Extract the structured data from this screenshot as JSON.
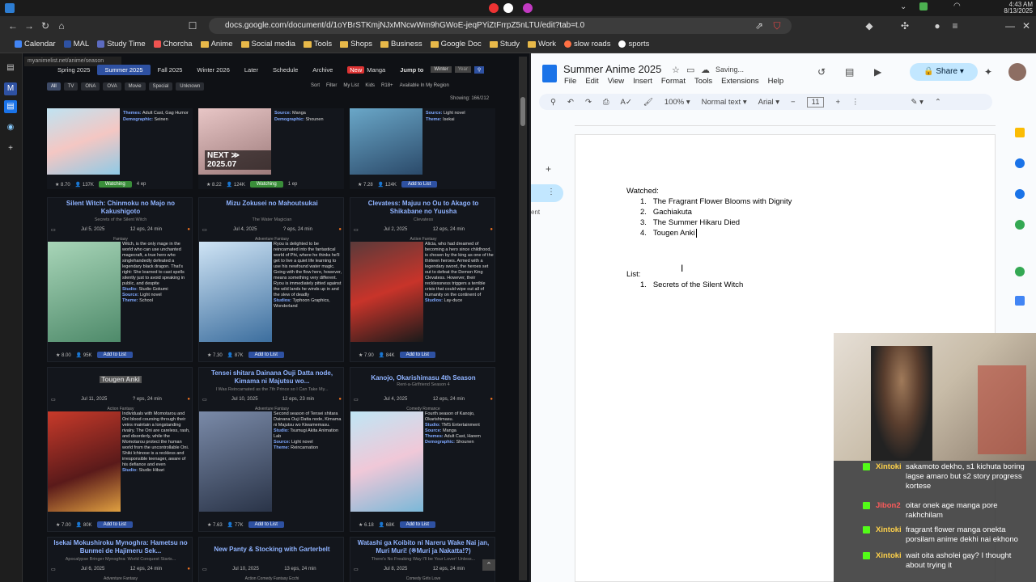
{
  "browser": {
    "url": "docs.google.com/document/d/1oYBrSTKmjNJxMNcwWm9hGWoE-jeqPYiZtFrrpZ5nLTU/edit?tab=t.0",
    "datetime_time": "4:43 AM",
    "datetime_date": "8/13/2025",
    "tooltip_url": "myanimelist.net/anime/season",
    "bookmarks": [
      "Calendar",
      "MAL",
      "Study Time",
      "Chorcha",
      "Anime",
      "Social media",
      "Tools",
      "Shops",
      "Business",
      "Google Doc",
      "Study",
      "Work",
      "slow roads",
      "sports"
    ]
  },
  "mal": {
    "season_tabs": [
      "Spring 2025",
      "Summer 2025",
      "Fall 2025",
      "Winter 2026",
      "Later",
      "Schedule",
      "Archive"
    ],
    "active_tab": "Summer 2025",
    "new_badge": "New",
    "manga_link": "Manga",
    "jump_to": "Jump to",
    "jump_select": "Winter",
    "jump_year": "Year",
    "filters": [
      "All",
      "TV",
      "ONA",
      "OVA",
      "Movie",
      "Special",
      "Unknown"
    ],
    "sort_opts": [
      "Sort",
      "Filter",
      "My List",
      "Kids",
      "R18+",
      "Available In My Region"
    ],
    "showing": "Showing: 166/212",
    "top_row": [
      {
        "themes_label": "Themes:",
        "themes": "Adult Cast, Gag Humor",
        "demo_label": "Demographic:",
        "demo": "Seinen",
        "score": "8.70",
        "members": "137K",
        "status": "Watching",
        "eps": "4 ep"
      },
      {
        "source_label": "Source:",
        "source": "Manga",
        "demo_label": "Demographic:",
        "demo": "Shounen",
        "banner": "NEXT ≫ 2025.07",
        "score": "8.22",
        "members": "124K",
        "status": "Watching",
        "eps": "1 ep"
      },
      {
        "source_label": "Source:",
        "source": "Light novel",
        "themes_label": "Theme:",
        "themes": "Isekai",
        "score": "7.28",
        "members": "124K",
        "status": "Add to List"
      }
    ],
    "cards": [
      {
        "title": "Silent Witch: Chinmoku no Majo no Kakushigoto",
        "subtitle": "Secrets of the Silent Witch",
        "date": "Jul 5, 2025",
        "eps": "12 eps, 24 min",
        "genres": "Fantasy",
        "synopsis": "Witch, is the only mage in the world who can use unchanted magecraft, a true hero who singlehandedly defeated a legendary black dragon. That's right: She learned to cast spells silently just to avoid speaking in public, and despite",
        "studio_label": "Studio:",
        "studio": "Studio Gokumi",
        "source_label": "Source:",
        "source": "Light novel",
        "theme_label": "Theme:",
        "theme": "School",
        "score": "8.00",
        "members": "95K",
        "action": "Add to List"
      },
      {
        "title": "Mizu Zokusei no Mahoutsukai",
        "subtitle": "The Water Magician",
        "date": "Jul 4, 2025",
        "eps": "? eps, 24 min",
        "genres": "Adventure  Fantasy",
        "synopsis": "Ryou is delighted to be reincarnated into the fantastical world of Phi, where he thinks he'll get to live a quiet life learning to use his newfound water magic. Going with the flow here, however, means something very different. Ryou is immediately pitted against the wild lands he winds up in and the slew of deadly",
        "studio_label": "Studios:",
        "studio": "Typhoon Graphics, Wonderland",
        "score": "7.30",
        "members": "87K",
        "action": "Add to List"
      },
      {
        "title": "Clevatess: Majuu no Ou to Akago to Shikabane no Yuusha",
        "subtitle": "Clevatess",
        "date": "Jul 2, 2025",
        "eps": "12 eps, 24 min",
        "genres": "Action  Fantasy",
        "synopsis": "Alicia, who had dreamed of becoming a hero since childhood, is chosen by the king as one of the thirteen heroes. Armed with a legendary sword, the heroes set out to defeat the Demon King Clevatess. However, their recklessness triggers a terrible crisis that could wipe out all of humanity on the continent of",
        "studio_label": "Studios:",
        "studio": "Lay-duce",
        "score": "7.90",
        "members": "84K",
        "action": "Add to List"
      },
      {
        "title": "Tougen Anki",
        "subtitle": "",
        "date": "Jul 11, 2025",
        "eps": "? eps, 24 min",
        "genres": "Action  Fantasy",
        "synopsis": "Individuals with Momotarou and Oni blood coursing through their veins maintain a longstanding rivalry. The Oni are careless, rash, and disorderly, while the Momotarou protect the human world from the uncontrollable Oni. Shiki Ichinose is a reckless and irresponsible teenager, aware of his defiance and even",
        "studio_label": "Studio:",
        "studio": "Studio Hibari",
        "score": "7.00",
        "members": "80K",
        "action": "Add to List"
      },
      {
        "title": "Tensei shitara Dainana Ouji Datta node, Kimama ni Majutsu wo...",
        "subtitle": "I Was Reincarnated as the 7th Prince so I Can Take My...",
        "date": "Jul 10, 2025",
        "eps": "12 eps, 23 min",
        "genres": "Adventure  Fantasy",
        "synopsis": "Second season of Tensei shitara Dainana Ouji Datta node, Kimama ni Majutsu wo Kiwamemasu.",
        "studio_label": "Studio:",
        "studio": "Tsumugi Akita Animation Lab",
        "source_label": "Source:",
        "source": "Light novel",
        "theme_label": "Theme:",
        "theme": "Reincarnation",
        "score": "7.63",
        "members": "77K",
        "action": "Add to List"
      },
      {
        "title": "Kanojo, Okarishimasu 4th Season",
        "subtitle": "Rent-a-Girlfriend Season 4",
        "date": "Jul 4, 2025",
        "eps": "12 eps, 24 min",
        "genres": "Comedy  Romance",
        "synopsis": "Fourth season of Kanojo, Okarishimasu.",
        "studio_label": "Studio:",
        "studio": "TMS Entertainment",
        "source_label": "Source:",
        "source": "Manga",
        "theme_label": "Themes:",
        "theme": "Adult Cast, Harem",
        "demo_label": "Demographic:",
        "demo": "Shounen",
        "score": "6.18",
        "members": "68K",
        "action": "Add to List"
      }
    ],
    "bottom_row": [
      {
        "title": "Isekai Mokushiroku Mynoghra: Hametsu no Bunmei de Hajimeru Sek...",
        "subtitle": "Apocalypse Bringer Mynoghra: World Conquest Starts...",
        "date": "Jul 6, 2025",
        "eps": "12 eps, 24 min",
        "genres": "Adventure  Fantasy"
      },
      {
        "title": "New Panty & Stocking with Garterbelt",
        "subtitle": "",
        "date": "Jul 10, 2025",
        "eps": "13 eps, 24 min",
        "genres": "Action  Comedy  Fantasy  Ecchi"
      },
      {
        "title": "Watashi ga Koibito ni Nareru Wake Nai jan, Muri Muri! (※Muri ja Nakatta!?)",
        "subtitle": "There's No Freaking Way I'll be Your Lover! Unless...",
        "date": "Jul 8, 2025",
        "eps": "12 eps, 24 min",
        "genres": "Comedy  Girls Love"
      }
    ]
  },
  "docs": {
    "title": "Summer Anime 2025",
    "saving": "Saving...",
    "share": "Share",
    "menu": [
      "File",
      "Edit",
      "View",
      "Insert",
      "Format",
      "Tools",
      "Extensions",
      "Help"
    ],
    "zoom": "100%",
    "style": "Normal text",
    "font": "Arial",
    "font_size": "11",
    "side_text": "ent",
    "watched_heading": "Watched:",
    "watched": [
      "The Fragrant Flower Blooms with Dignity",
      "Gachiakuta",
      "The Summer Hikaru Died",
      "Tougen Anki"
    ],
    "list_heading": "List:",
    "list": [
      "Secrets of the Silent Witch"
    ]
  },
  "chat": [
    {
      "user": "Xintoki",
      "color": "#ffd24a",
      "text": "sakamoto dekho, s1 kichuta boring lagse amaro but s2 story progress kortese"
    },
    {
      "user": "Jibon2",
      "color": "#ff5b5b",
      "text": "oitar onek age manga pore rakhchilam"
    },
    {
      "user": "Xintoki",
      "color": "#ffd24a",
      "text": "fragrant flower manga onekta porsilam anime dekhi nai ekhono"
    },
    {
      "user": "Xintoki",
      "color": "#ffd24a",
      "text": "wait oita asholei gay? I thought about trying it"
    }
  ],
  "colors": {
    "mal_blue": "#2e51a2",
    "docs_share": "#c2e7ff",
    "kick_green": "#53fc18"
  }
}
